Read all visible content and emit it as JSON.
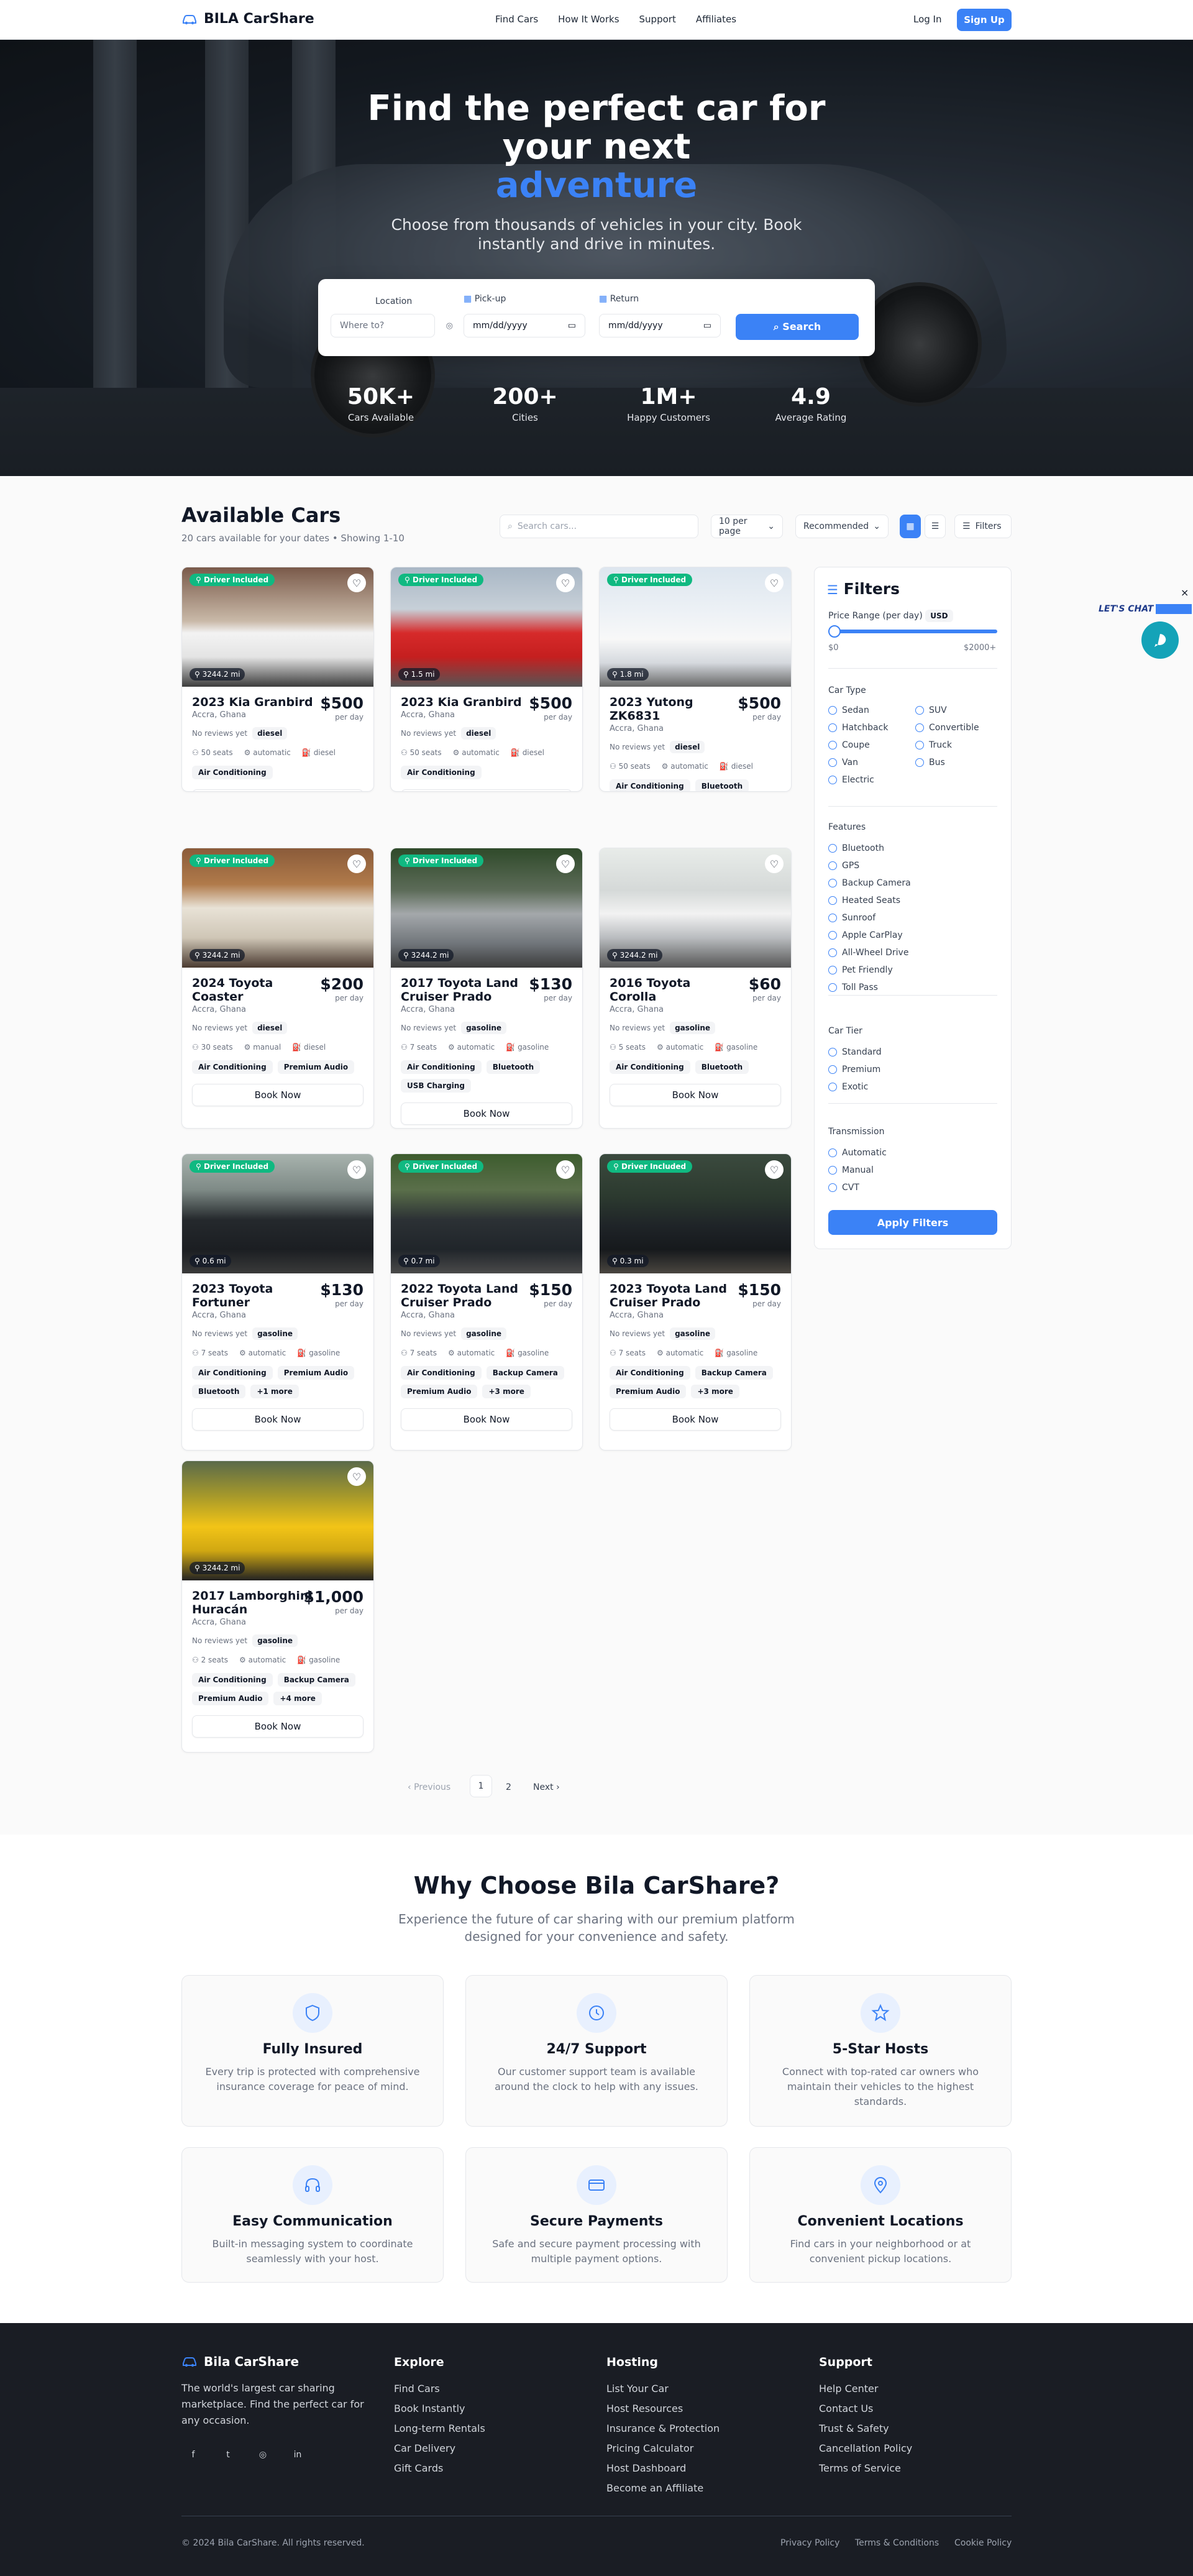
{
  "nav": {
    "brand": "BILA CarShare",
    "links": [
      "Find Cars",
      "How It Works",
      "Support",
      "Affiliates"
    ],
    "login": "Log In",
    "signup": "Sign Up"
  },
  "hero": {
    "title_line1": "Find the perfect car for",
    "title_line2": "your next",
    "title_accent": "adventure",
    "subtitle": "Choose from thousands of vehicles in your city. Book instantly and drive in minutes.",
    "search": {
      "location_label": "Location",
      "location_placeholder": "Where to?",
      "pickup_label": "Pick-up",
      "pickup_placeholder": "mm/dd/yyyy",
      "return_label": "Return",
      "return_placeholder": "mm/dd/yyyy",
      "button": "Search"
    },
    "stats": [
      {
        "value": "50K+",
        "label": "Cars Available"
      },
      {
        "value": "200+",
        "label": "Cities"
      },
      {
        "value": "1M+",
        "label": "Happy Customers"
      },
      {
        "value": "4.9",
        "label": "Average Rating"
      }
    ]
  },
  "listing": {
    "title": "Available Cars",
    "subtitle": "20 cars available for your dates • Showing 1-10",
    "search_placeholder": "Search cars...",
    "per_page": "10 per page",
    "sort": "Recommended",
    "filters_btn": "Filters",
    "driver_badge": "Driver Included",
    "no_reviews": "No reviews yet",
    "per_day": "per day",
    "book": "Book Now",
    "cars": [
      {
        "name": "2023 Kia Granbird",
        "loc": "Accra, Ghana",
        "price": "$500",
        "dist": "3244.2 mi",
        "fuel": "diesel",
        "seats": "50 seats",
        "trans": "automatic",
        "feats": [
          "Air Conditioning"
        ],
        "driver": true
      },
      {
        "name": "2023 Kia Granbird",
        "loc": "Accra, Ghana",
        "price": "$500",
        "dist": "1.5 mi",
        "fuel": "diesel",
        "seats": "50 seats",
        "trans": "automatic",
        "feats": [
          "Air Conditioning"
        ],
        "driver": true
      },
      {
        "name": "2023 Yutong ZK6831",
        "loc": "Accra, Ghana",
        "price": "$500",
        "dist": "1.8 mi",
        "fuel": "diesel",
        "seats": "50 seats",
        "trans": "automatic",
        "feats": [
          "Air Conditioning",
          "Bluetooth"
        ],
        "driver": true
      },
      {
        "name": "2024 Toyota Coaster",
        "loc": "Accra, Ghana",
        "price": "$200",
        "dist": "3244.2 mi",
        "fuel": "diesel",
        "seats": "30 seats",
        "trans": "manual",
        "feats": [
          "Air Conditioning",
          "Premium Audio"
        ],
        "driver": true
      },
      {
        "name": "2017 Toyota Land Cruiser Prado",
        "loc": "Accra, Ghana",
        "price": "$130",
        "dist": "3244.2 mi",
        "fuel": "gasoline",
        "seats": "7 seats",
        "trans": "automatic",
        "feats": [
          "Air Conditioning",
          "Bluetooth",
          "USB Charging"
        ],
        "driver": true
      },
      {
        "name": "2016 Toyota Corolla",
        "loc": "Accra, Ghana",
        "price": "$60",
        "dist": "3244.2 mi",
        "fuel": "gasoline",
        "seats": "5 seats",
        "trans": "automatic",
        "feats": [
          "Air Conditioning",
          "Bluetooth"
        ],
        "driver": false
      },
      {
        "name": "2023 Toyota Fortuner",
        "loc": "Accra, Ghana",
        "price": "$130",
        "dist": "0.6 mi",
        "fuel": "gasoline",
        "seats": "7 seats",
        "trans": "automatic",
        "feats": [
          "Air Conditioning",
          "Premium Audio",
          "Bluetooth",
          "+1 more"
        ],
        "driver": true
      },
      {
        "name": "2022 Toyota Land Cruiser Prado",
        "loc": "Accra, Ghana",
        "price": "$150",
        "dist": "0.7 mi",
        "fuel": "gasoline",
        "seats": "7 seats",
        "trans": "automatic",
        "feats": [
          "Air Conditioning",
          "Backup Camera",
          "Premium Audio",
          "+3 more"
        ],
        "driver": true
      },
      {
        "name": "2023 Toyota Land Cruiser Prado",
        "loc": "Accra, Ghana",
        "price": "$150",
        "dist": "0.3 mi",
        "fuel": "gasoline",
        "seats": "7 seats",
        "trans": "automatic",
        "feats": [
          "Air Conditioning",
          "Backup Camera",
          "Premium Audio",
          "+3 more"
        ],
        "driver": true
      },
      {
        "name": "2017 Lamborghini Huracán",
        "loc": "Accra, Ghana",
        "price": "$1,000",
        "dist": "3244.2 mi",
        "fuel": "gasoline",
        "seats": "2 seats",
        "trans": "automatic",
        "feats": [
          "Air Conditioning",
          "Backup Camera",
          "Premium Audio",
          "+4 more"
        ],
        "driver": false
      }
    ],
    "pagination": {
      "prev": "Previous",
      "pages": [
        "1",
        "2"
      ],
      "next": "Next"
    }
  },
  "filters": {
    "title": "Filters",
    "price_label": "Price Range (per day)",
    "currency": "USD",
    "min": "$0",
    "max": "$2000+",
    "car_type_label": "Car Type",
    "car_types": [
      "Sedan",
      "SUV",
      "Hatchback",
      "Convertible",
      "Coupe",
      "Truck",
      "Van",
      "Bus",
      "Electric"
    ],
    "features_label": "Features",
    "features": [
      "Bluetooth",
      "GPS",
      "Backup Camera",
      "Heated Seats",
      "Sunroof",
      "Apple CarPlay",
      "All-Wheel Drive",
      "Pet Friendly",
      "Toll Pass"
    ],
    "tier_label": "Car Tier",
    "tiers": [
      "Standard",
      "Premium",
      "Exotic"
    ],
    "trans_label": "Transmission",
    "transmissions": [
      "Automatic",
      "Manual",
      "CVT"
    ],
    "apply": "Apply Filters"
  },
  "chat": {
    "label": "LET'S CHAT",
    "close": "×"
  },
  "why": {
    "title": "Why Choose Bila CarShare?",
    "lead": "Experience the future of car sharing with our premium platform designed for your convenience and safety.",
    "items": [
      {
        "title": "Fully Insured",
        "text": "Every trip is protected with comprehensive insurance coverage for peace of mind.",
        "icon": "shield-icon"
      },
      {
        "title": "24/7 Support",
        "text": "Our customer support team is available around the clock to help with any issues.",
        "icon": "clock-icon"
      },
      {
        "title": "5-Star Hosts",
        "text": "Connect with top-rated car owners who maintain their vehicles to the highest standards.",
        "icon": "star-icon"
      },
      {
        "title": "Easy Communication",
        "text": "Built-in messaging system to coordinate seamlessly with your host.",
        "icon": "headphones-icon"
      },
      {
        "title": "Secure Payments",
        "text": "Safe and secure payment processing with multiple payment options.",
        "icon": "credit-card-icon"
      },
      {
        "title": "Convenient Locations",
        "text": "Find cars in your neighborhood or at convenient pickup locations.",
        "icon": "map-pin-icon"
      }
    ]
  },
  "footer": {
    "brand": "Bila CarShare",
    "desc": "The world's largest car sharing marketplace. Find the perfect car for any occasion.",
    "cols": [
      {
        "title": "Explore",
        "links": [
          "Find Cars",
          "Book Instantly",
          "Long-term Rentals",
          "Car Delivery",
          "Gift Cards"
        ]
      },
      {
        "title": "Hosting",
        "links": [
          "List Your Car",
          "Host Resources",
          "Insurance & Protection",
          "Pricing Calculator",
          "Host Dashboard",
          "Become an Affiliate"
        ]
      },
      {
        "title": "Support",
        "links": [
          "Help Center",
          "Contact Us",
          "Trust & Safety",
          "Cancellation Policy",
          "Terms of Service"
        ]
      }
    ],
    "copyright": "© 2024 Bila CarShare. All rights reserved.",
    "legal": [
      "Privacy Policy",
      "Terms & Conditions",
      "Cookie Policy"
    ],
    "social": [
      "facebook-icon",
      "twitter-icon",
      "instagram-icon",
      "linkedin-icon"
    ]
  },
  "colors": {
    "accent": "#3b82f6",
    "badge": "#10b981",
    "footer": "#1a1d24",
    "chat": "#14a3b8"
  }
}
